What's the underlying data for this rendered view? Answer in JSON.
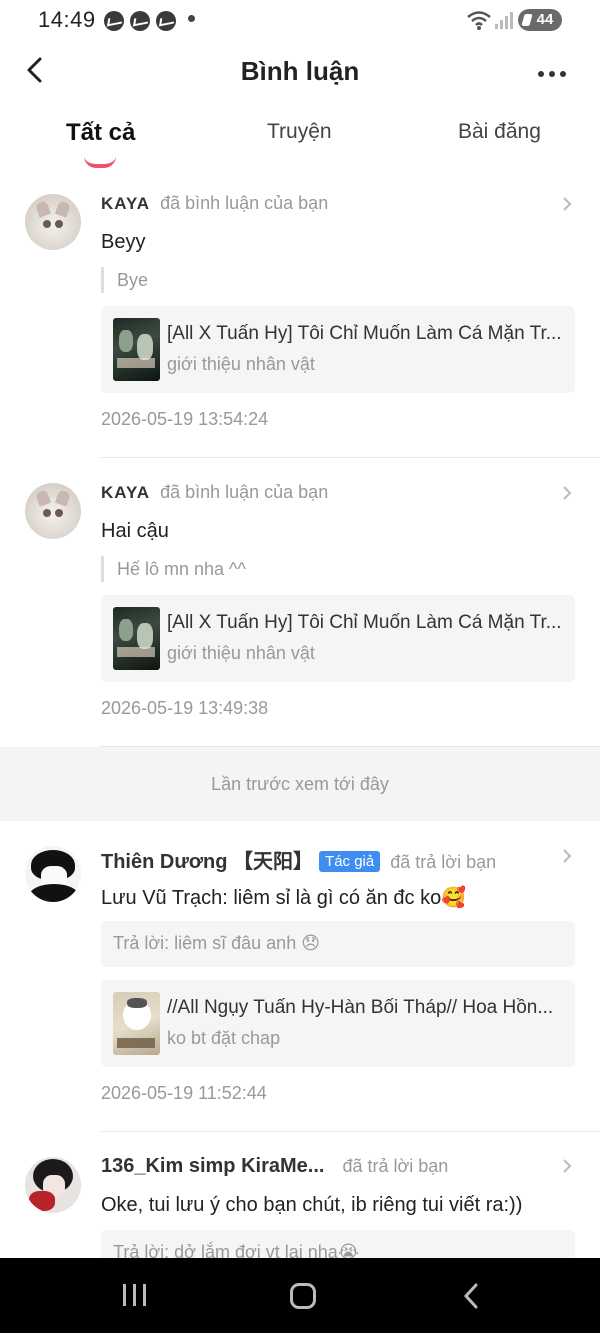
{
  "status_bar": {
    "time": "14:49",
    "battery": "44"
  },
  "header": {
    "title": "Bình luận"
  },
  "tabs": [
    {
      "label": "Tất cả",
      "active": true
    },
    {
      "label": "Truyện",
      "active": false
    },
    {
      "label": "Bài đăng",
      "active": false
    }
  ],
  "comments": [
    {
      "username": "KAYA",
      "action": "đã bình luận của bạn",
      "text": "Beyy",
      "quote": "Bye",
      "story_title": "[All X Tuấn Hy] Tôi Chỉ Muốn Làm Cá Mặn Tr...",
      "story_sub": "giới thiệu nhân vật",
      "timestamp": "2026-05-19 13:54:24"
    },
    {
      "username": "KAYA",
      "action": "đã bình luận của bạn",
      "text": "Hai cậu",
      "quote": "Hế lô mn nha ^^",
      "story_title": "[All X Tuấn Hy] Tôi Chỉ Muốn Làm Cá Mặn Tr...",
      "story_sub": "giới thiệu nhân vật",
      "timestamp": "2026-05-19 13:49:38"
    },
    {
      "username": "Thiên Dương 【天阳】",
      "tag": "Tác giả",
      "action": "đã trả lời bạn",
      "text": "Lưu Vũ Trạch: liêm sỉ là gì có ăn đc ko🥰",
      "reply": "Trả lời: liêm sĩ đâu anh 😞",
      "story_title": "//All Ngụy Tuấn Hy-Hàn Bối Tháp// Hoa Hồn...",
      "story_sub": "ko bt đặt chap",
      "timestamp": "2026-05-19 11:52:44"
    },
    {
      "username": "136_Kim simp KiraMe...",
      "action": "đã trả lời bạn",
      "text": "Oke, tui lưu ý cho bạn chút, ib riêng tui viết ra:))",
      "reply": "Trả lời: dở lắm đợi vt lại nha😭"
    }
  ],
  "last_seen_label": "Lần trước xem tới đây",
  "colors": {
    "accent": "#f0506e",
    "author_tag": "#3d8ef0"
  }
}
